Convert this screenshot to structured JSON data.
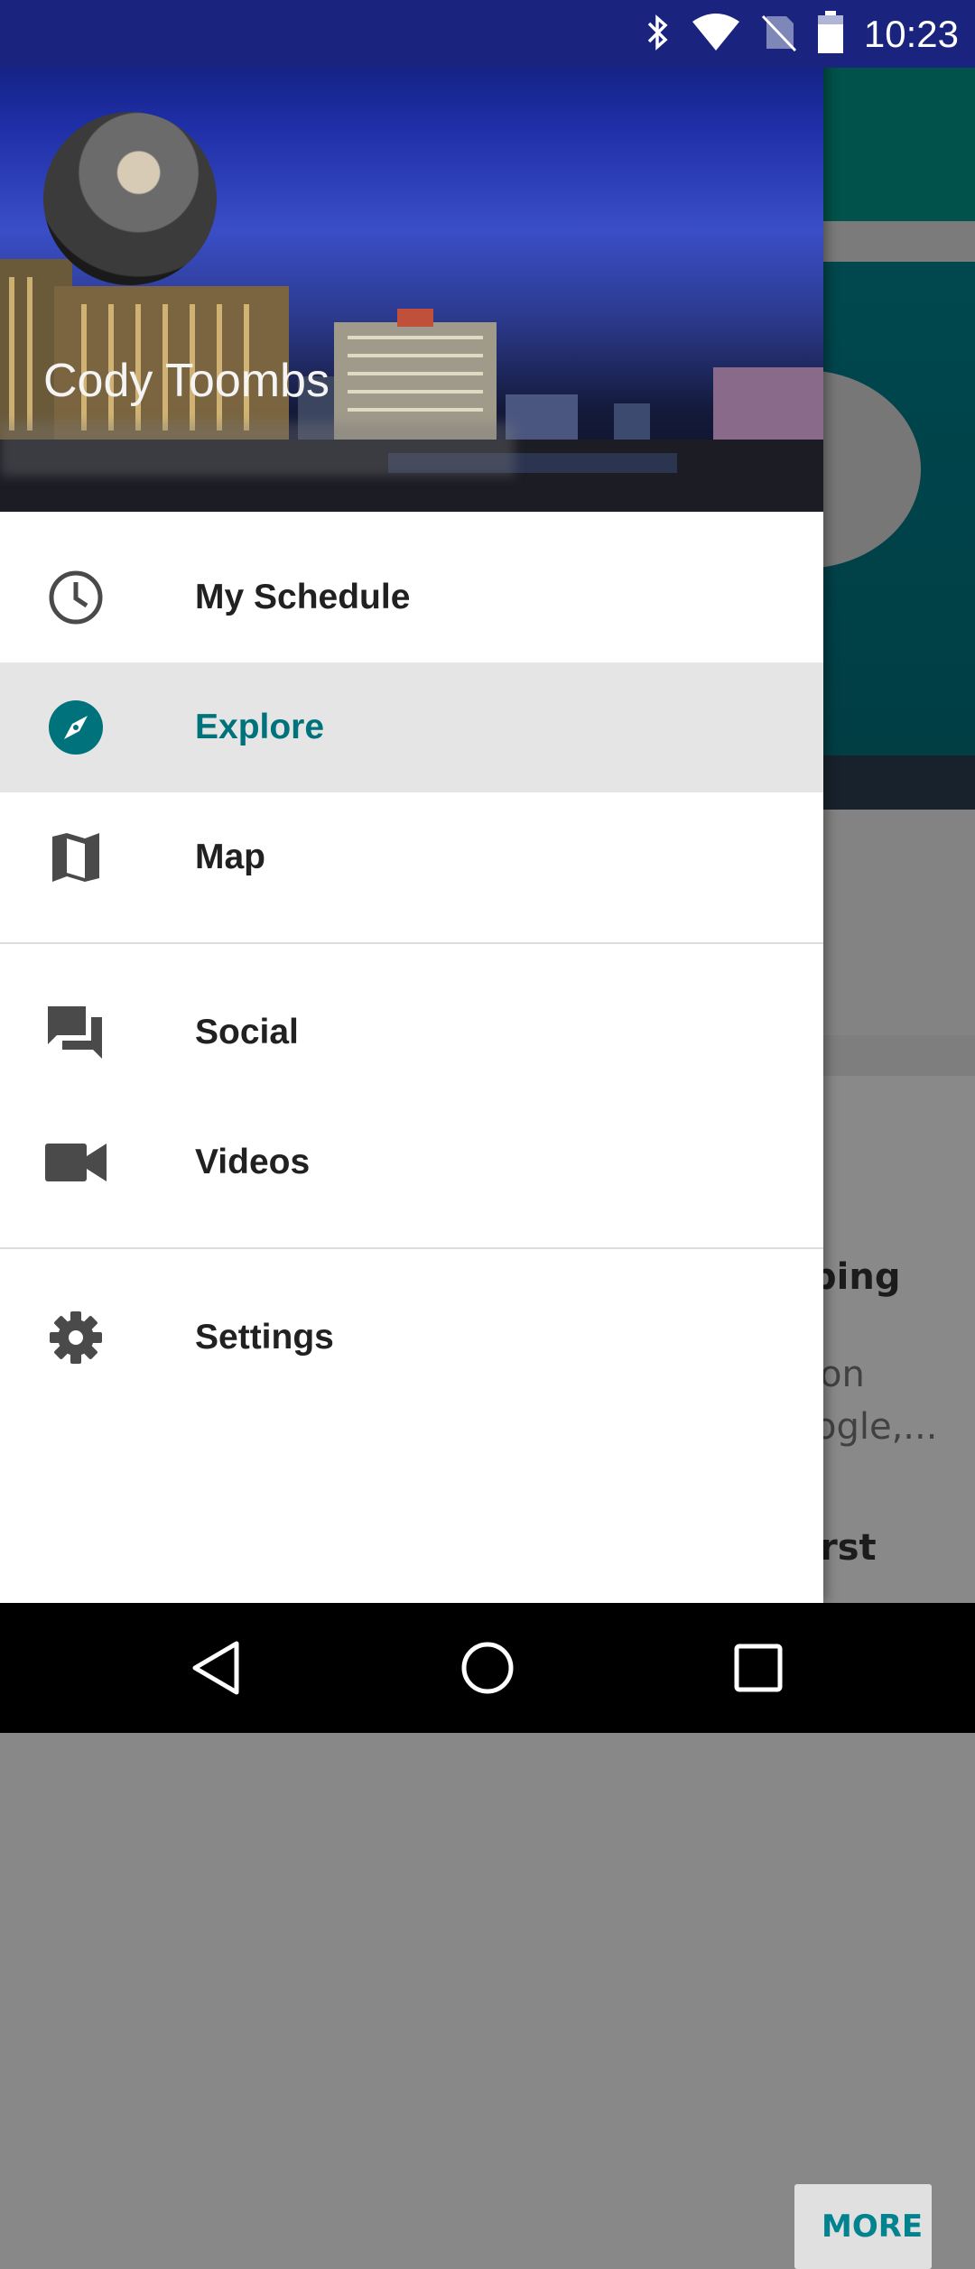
{
  "status_bar": {
    "time": "10:23",
    "icons": [
      "bluetooth-icon",
      "wifi-icon",
      "no-sim-icon",
      "battery-icon"
    ]
  },
  "background": {
    "more_button": "MORE",
    "text_1": "ping",
    "text_2": "on",
    "text_3": "ogle,...",
    "text_4": "rst"
  },
  "drawer": {
    "user_name": "Cody Toombs",
    "menu": [
      {
        "label": "My Schedule",
        "icon": "clock-icon",
        "active": false
      },
      {
        "label": "Explore",
        "icon": "compass-icon",
        "active": true
      },
      {
        "label": "Map",
        "icon": "map-icon",
        "active": false
      },
      {
        "label": "Social",
        "icon": "forum-icon",
        "active": false
      },
      {
        "label": "Videos",
        "icon": "videocam-icon",
        "active": false
      },
      {
        "label": "Settings",
        "icon": "gear-icon",
        "active": false
      }
    ],
    "active_color": "#00727c"
  },
  "nav_bar": {
    "buttons": [
      "back-icon",
      "home-icon",
      "recents-icon"
    ]
  }
}
